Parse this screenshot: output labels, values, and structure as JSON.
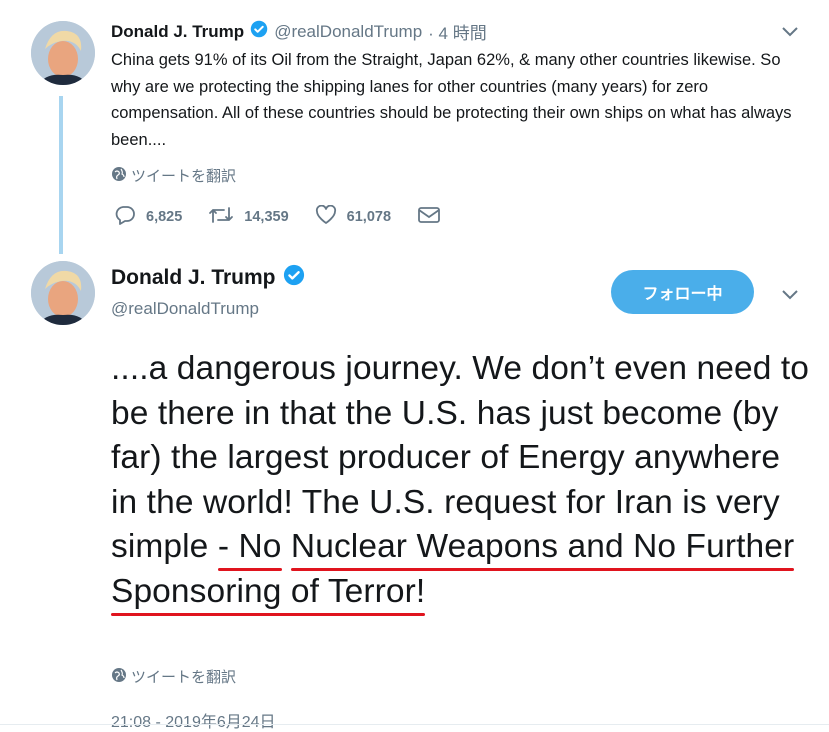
{
  "tweet1": {
    "name": "Donald J. Trump",
    "handle": "@realDonaldTrump",
    "time": "· 4 時間",
    "text": "China gets 91% of its Oil from the Straight, Japan 62%, & many other countries likewise. So why are we protecting the shipping lanes for other countries (many years) for zero compensation. All of these countries should be protecting their own ships on what has always been....",
    "translate_label": "ツイートを翻訳",
    "replies": "6,825",
    "retweets": "14,359",
    "likes": "61,078"
  },
  "tweet2": {
    "name": "Donald J. Trump",
    "handle": "@realDonaldTrump",
    "follow_label": "フォロー中",
    "text_plain": "....a dangerous journey. We don’t even need to be there in that the U.S. has just become (by far) the largest producer of Energy anywhere in the world! The U.S. request for Iran is very simple ",
    "text_underlined_1": "- No",
    "text_underlined_2": "Nuclear Weapons and No Further",
    "text_underlined_3": "Sponsoring of Terror!",
    "translate_label": "ツイートを翻訳",
    "timestamp": "21:08 - 2019年6月24日"
  },
  "colors": {
    "accent": "#4aaeea",
    "thread_line": "#a8d5f0",
    "muted": "#657786",
    "annotation_red": "#e0141e"
  },
  "icons": [
    "verified-badge-icon",
    "chevron-down-icon",
    "globe-icon",
    "reply-icon",
    "retweet-icon",
    "like-icon",
    "dm-icon"
  ]
}
